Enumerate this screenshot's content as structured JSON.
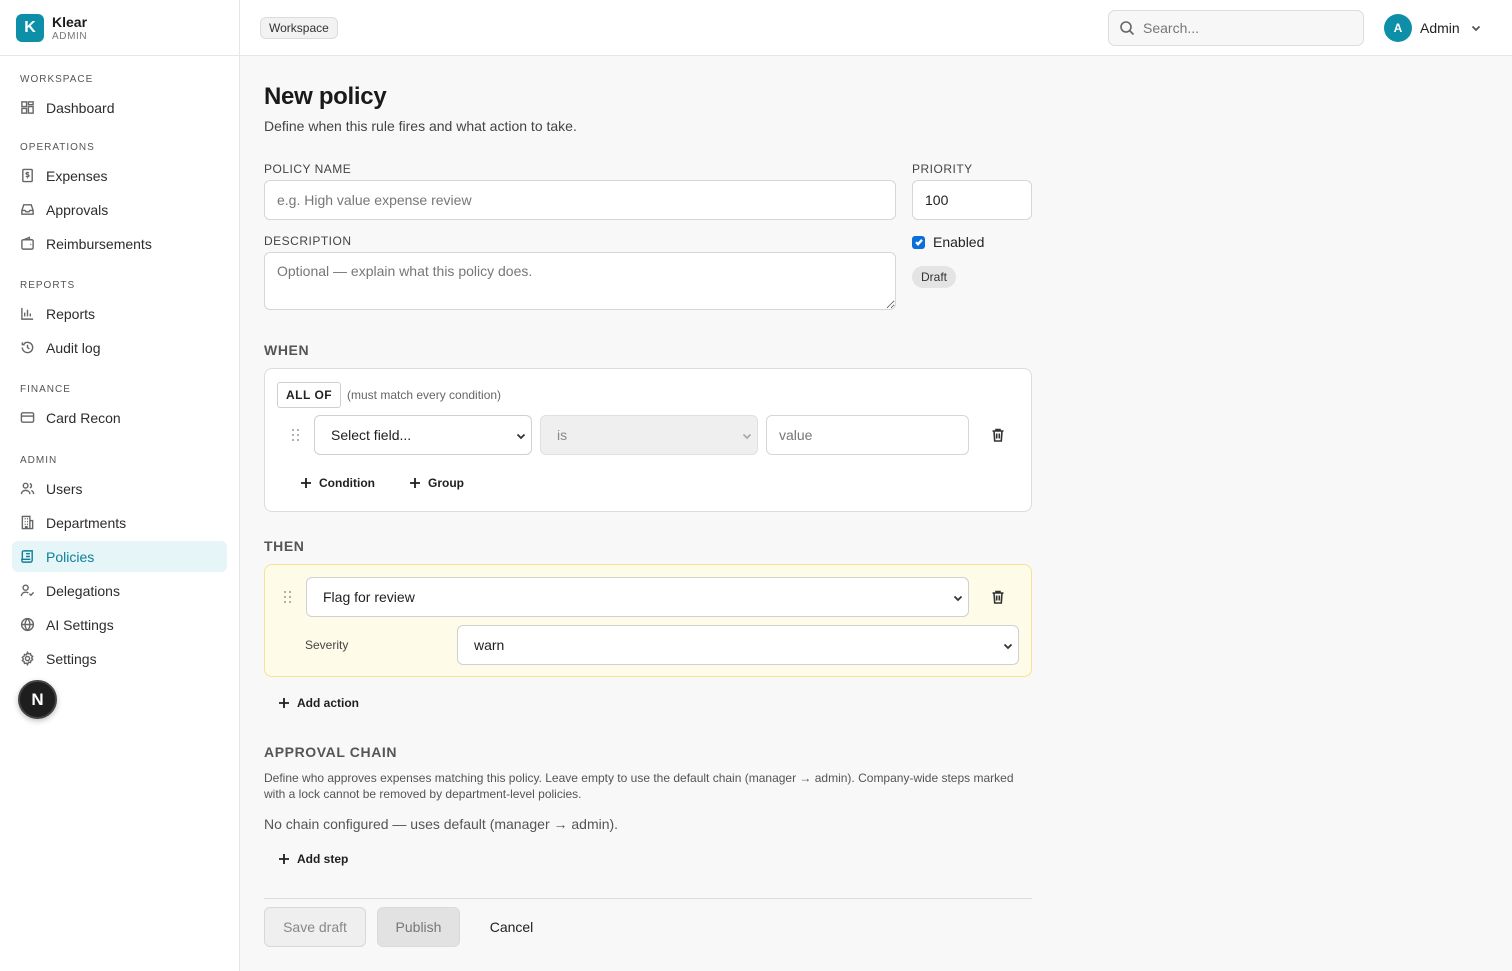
{
  "brand": {
    "logo_letter": "K",
    "name": "Klear",
    "subtitle": "ADMIN",
    "accent": "#0e8fa8"
  },
  "sidebar": {
    "sections": [
      {
        "title": "WORKSPACE",
        "items": [
          {
            "label": "Dashboard",
            "icon": "dashboard-icon"
          }
        ]
      },
      {
        "title": "OPERATIONS",
        "items": [
          {
            "label": "Expenses",
            "icon": "receipt-icon"
          },
          {
            "label": "Approvals",
            "icon": "inbox-icon"
          },
          {
            "label": "Reimbursements",
            "icon": "wallet-icon"
          }
        ]
      },
      {
        "title": "REPORTS",
        "items": [
          {
            "label": "Reports",
            "icon": "bar-chart-icon"
          },
          {
            "label": "Audit log",
            "icon": "history-icon"
          }
        ]
      },
      {
        "title": "FINANCE",
        "items": [
          {
            "label": "Card Recon",
            "icon": "credit-card-icon"
          }
        ]
      },
      {
        "title": "ADMIN",
        "items": [
          {
            "label": "Users",
            "icon": "users-icon"
          },
          {
            "label": "Departments",
            "icon": "building-icon"
          },
          {
            "label": "Policies",
            "icon": "scroll-icon",
            "active": true
          },
          {
            "label": "Delegations",
            "icon": "user-check-icon"
          },
          {
            "label": "AI Settings",
            "icon": "globe-icon"
          },
          {
            "label": "Settings",
            "icon": "gear-icon"
          }
        ]
      }
    ],
    "dev_badge": "N"
  },
  "topbar": {
    "workspace_chip": "Workspace",
    "search_placeholder": "Search...",
    "user_initial": "A",
    "user_name": "Admin"
  },
  "form": {
    "title": "New policy",
    "subtitle": "Define when this rule fires and what action to take.",
    "policy_name_label": "POLICY NAME",
    "policy_name_placeholder": "e.g. High value expense review",
    "policy_name_value": "",
    "priority_label": "PRIORITY",
    "priority_value": "100",
    "description_label": "DESCRIPTION",
    "description_placeholder": "Optional — explain what this policy does.",
    "description_value": "",
    "enabled_label": "Enabled",
    "enabled": true,
    "status_badge": "Draft"
  },
  "when": {
    "title": "WHEN",
    "combinator": "ALL OF",
    "combinator_hint": "(must match every condition)",
    "condition": {
      "field_select": "Select field...",
      "operator_select": "is",
      "value_placeholder": "value"
    },
    "add_condition_label": "Condition",
    "add_group_label": "Group"
  },
  "then": {
    "title": "THEN",
    "action_select": "Flag for review",
    "severity_label": "Severity",
    "severity_select": "warn",
    "add_action_label": "Add action"
  },
  "approval_chain": {
    "title": "APPROVAL CHAIN",
    "description": "Define who approves expenses matching this policy. Leave empty to use the default chain (manager → admin). Company-wide steps marked with a lock cannot be removed by department-level policies.",
    "empty_text": "No chain configured — uses default (manager → admin).",
    "add_step_label": "Add step"
  },
  "footer": {
    "save_draft_label": "Save draft",
    "publish_label": "Publish",
    "cancel_label": "Cancel"
  }
}
